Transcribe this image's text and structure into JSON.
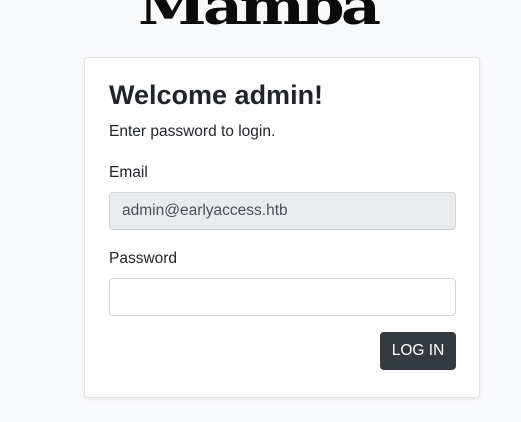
{
  "brand": {
    "logo_text": "Mamba"
  },
  "login_card": {
    "title": "Welcome admin!",
    "subtitle": "Enter password to login.",
    "email_label": "Email",
    "email_value": "admin@earlyaccess.htb",
    "password_label": "Password",
    "password_value": "",
    "submit_label": "LOG IN"
  },
  "colors": {
    "page_background": "#f8f9fb",
    "card_background": "#ffffff",
    "readonly_field_background": "#e9ecef",
    "button_background": "#343a40",
    "button_text": "#ffffff"
  }
}
